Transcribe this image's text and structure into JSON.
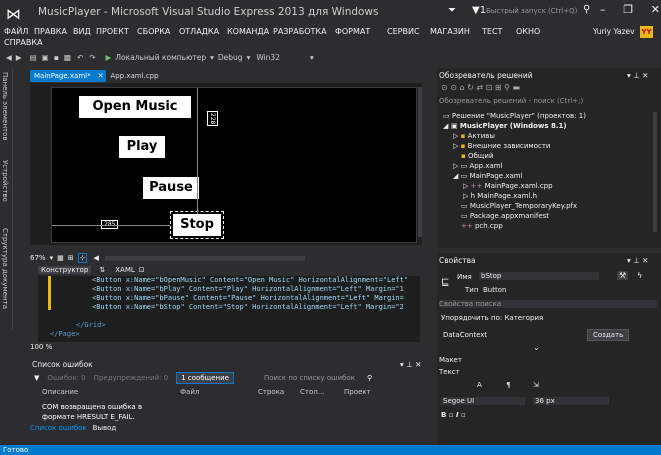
{
  "window": {
    "title": "MusicPlayer - Microsoft Visual Studio Express 2013 для Windows",
    "quick_launch": "Быстрый запуск (Ctrl+Q)",
    "user": "Yuriy Yazev",
    "avatar": "YY"
  },
  "menu": [
    "ФАЙЛ",
    "ПРАВКА",
    "ВИД",
    "ПРОЕКТ",
    "СБОРКА",
    "ОТЛАДКА",
    "КОМАНДА",
    "РАЗРАБОТКА",
    "ФОРМАТ",
    "СЕРВИС",
    "МАГАЗИН",
    "ТЕСТ",
    "ОКНО",
    "СПРАВКА"
  ],
  "toolbar": {
    "run_target": "Локальный компьютер",
    "config": "Debug",
    "platform": "Win32"
  },
  "left_tabs": [
    "Панель элементов",
    "Устройство",
    "Структура документа"
  ],
  "doc_tabs": [
    "MainPage.xaml*",
    "App.xaml.cpp"
  ],
  "designer": {
    "buttons": [
      "Open Music",
      "Play",
      "Pause",
      "Stop"
    ],
    "measure_right": "285",
    "measure_top": "228"
  },
  "zoom": "67%",
  "split": {
    "design_tab": "Конструктор",
    "xaml_tab": "XAML"
  },
  "xaml_lines": [
    "<Button x:Name=\"bOpenMusic\" Content=\"Open Music\" HorizontalAlignment=\"Left\"",
    "<Button x:Name=\"bPlay\" Content=\"Play\" HorizontalAlignment=\"Left\" Margin=\"1",
    "<Button x:Name=\"bPause\" Content=\"Pause\" HorizontalAlignment=\"Left\" Margin=",
    "<Button x:Name=\"bStop\" Content=\"Stop\" HorizontalAlignment=\"Left\" Margin=\"2",
    "</Grid>",
    "</Page>"
  ],
  "xaml_zoom": "100 %",
  "errors": {
    "title": "Список ошибок",
    "errors_btn": "Ошибок: 0",
    "warnings_btn": "Предупреждений: 0",
    "messages_btn": "1 сообщение",
    "search": "Поиск по списку ошибок",
    "cols": [
      "Описание",
      "Файл",
      "Строка",
      "Стол...",
      "Проект"
    ],
    "row_text": "COM возвращена ошибка в формате HRESULT E_FAIL.",
    "tabs": [
      "Список ошибок",
      "Вывод"
    ]
  },
  "solution": {
    "title": "Обозреватель решений",
    "search": "Обозреватель решений - поиск (Ctrl+;)",
    "items": [
      "Решение \"MusicPlayer\" (проектов: 1)",
      "MusicPlayer (Windows 8.1)",
      "Активы",
      "Внешние зависимости",
      "Общий",
      "App.xaml",
      "MainPage.xaml",
      "MainPage.xaml.cpp",
      "MainPage.xaml.h",
      "MusicPlayer_TemporaryKey.pfx",
      "Package.appxmanifest",
      "pch.cpp"
    ]
  },
  "props": {
    "title": "Свойства",
    "name_label": "Имя",
    "name_value": "bStop",
    "type_label": "Тип",
    "type_value": "Button",
    "search": "Свойства поиска",
    "sort": "Упорядочить по: Категория",
    "datacontext": "DataContext",
    "create": "Создать",
    "layout": "Макет",
    "text": "Текст",
    "font": "Segoe UI",
    "size": "36 px"
  },
  "status": "Готово"
}
